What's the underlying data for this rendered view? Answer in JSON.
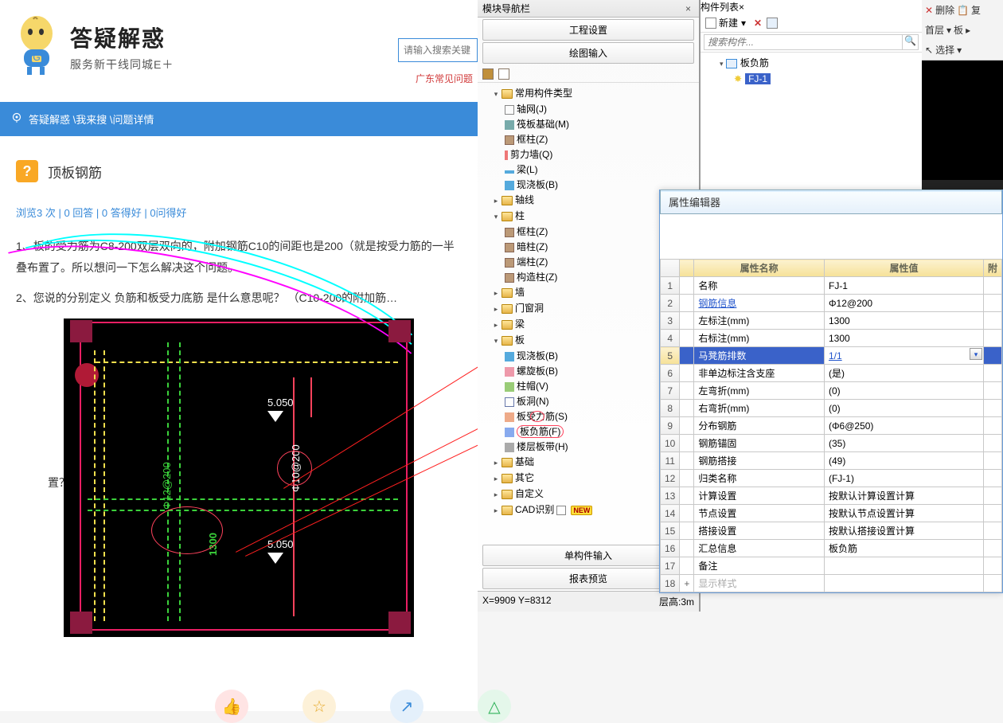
{
  "logo": {
    "title": "答疑解惑",
    "sub": "服务新干线同城E＋"
  },
  "search_placeholder": "请输入搜索关键",
  "common_questions": "广东常见问题",
  "breadcrumb": "答疑解惑 \\我来搜 \\问题详情",
  "question_title": "顶板钢筋",
  "meta": "浏览3 次 | 0 回答 | 0 答得好 | 0问得好",
  "para1": "1、板的受力筋为C8-200双层双向的，附加钢筋C10的间距也是200（就是按受力筋的一半叠布置了。所以想问一下怎么解决这个问题。",
  "para2": "2、您说的分别定义 负筋和板受力底筋 是什么意思呢？  （C10-200的附加筋…",
  "figure_label": "置？）",
  "cad_dims": {
    "t1": "5.050",
    "t2": "5.050",
    "g1": "Φ12@200",
    "g2": "1300",
    "w1": "Φ10@200"
  },
  "panel_nav_title": "模块导航栏",
  "nav_tabs": {
    "a": "工程设置",
    "b": "绘图输入"
  },
  "tree": {
    "root": "常用构件类型",
    "items": [
      "轴网(J)",
      "筏板基础(M)",
      "框柱(Z)",
      "剪力墙(Q)",
      "梁(L)",
      "现浇板(B)"
    ],
    "g_axis": "轴线",
    "g_col": "柱",
    "col_items": [
      "框柱(Z)",
      "暗柱(Z)",
      "端柱(Z)",
      "构造柱(Z)"
    ],
    "g_wall": "墙",
    "g_open": "门窗洞",
    "g_beam": "梁",
    "g_slab": "板",
    "slab_items": [
      "现浇板(B)",
      "螺旋板(B)",
      "柱帽(V)",
      "板洞(N)",
      "板受力筋(S)",
      "板负筋(F)",
      "楼层板带(H)"
    ],
    "g_found": "基础",
    "g_other": "其它",
    "g_custom": "自定义",
    "g_cad": "CAD识别",
    "new_badge": "NEW"
  },
  "bot_tabs": {
    "a": "单构件输入",
    "b": "报表预览"
  },
  "status": {
    "coord": "X=9909 Y=8312",
    "floor": "层高:3m"
  },
  "comp_list_title": "构件列表",
  "comp_toolbar_new": "新建",
  "comp_search_placeholder": "搜索构件...",
  "comp_tree": {
    "root": "板负筋",
    "child": "FJ-1"
  },
  "right_tools": {
    "del": "删除",
    "dup": "复",
    "floor": "首层",
    "type": "板",
    "sel": "选择"
  },
  "prop_title": "属性编辑器",
  "prop_cols": {
    "name": "属性名称",
    "value": "属性值",
    "extra": "附"
  },
  "prop_rows": [
    {
      "n": "1",
      "name": "名称",
      "value": "FJ-1"
    },
    {
      "n": "2",
      "name": "钢筋信息",
      "value": "Φ12@200",
      "link": true
    },
    {
      "n": "3",
      "name": "左标注(mm)",
      "value": "1300"
    },
    {
      "n": "4",
      "name": "右标注(mm)",
      "value": "1300"
    },
    {
      "n": "5",
      "name": "马凳筋排数",
      "value": "1/1",
      "selected": true
    },
    {
      "n": "6",
      "name": "非单边标注含支座",
      "value": "(是)"
    },
    {
      "n": "7",
      "name": "左弯折(mm)",
      "value": "(0)"
    },
    {
      "n": "8",
      "name": "右弯折(mm)",
      "value": "(0)"
    },
    {
      "n": "9",
      "name": "分布钢筋",
      "value": "(Φ6@250)"
    },
    {
      "n": "10",
      "name": "钢筋锚固",
      "value": "(35)"
    },
    {
      "n": "11",
      "name": "钢筋搭接",
      "value": "(49)"
    },
    {
      "n": "12",
      "name": "归类名称",
      "value": "(FJ-1)"
    },
    {
      "n": "13",
      "name": "计算设置",
      "value": "按默认计算设置计算"
    },
    {
      "n": "14",
      "name": "节点设置",
      "value": "按默认节点设置计算"
    },
    {
      "n": "15",
      "name": "搭接设置",
      "value": "按默认搭接设置计算"
    },
    {
      "n": "16",
      "name": "汇总信息",
      "value": "板负筋"
    },
    {
      "n": "17",
      "name": "备注",
      "value": ""
    },
    {
      "n": "18",
      "name": "显示样式",
      "value": "",
      "grey": true,
      "plus": true
    }
  ]
}
